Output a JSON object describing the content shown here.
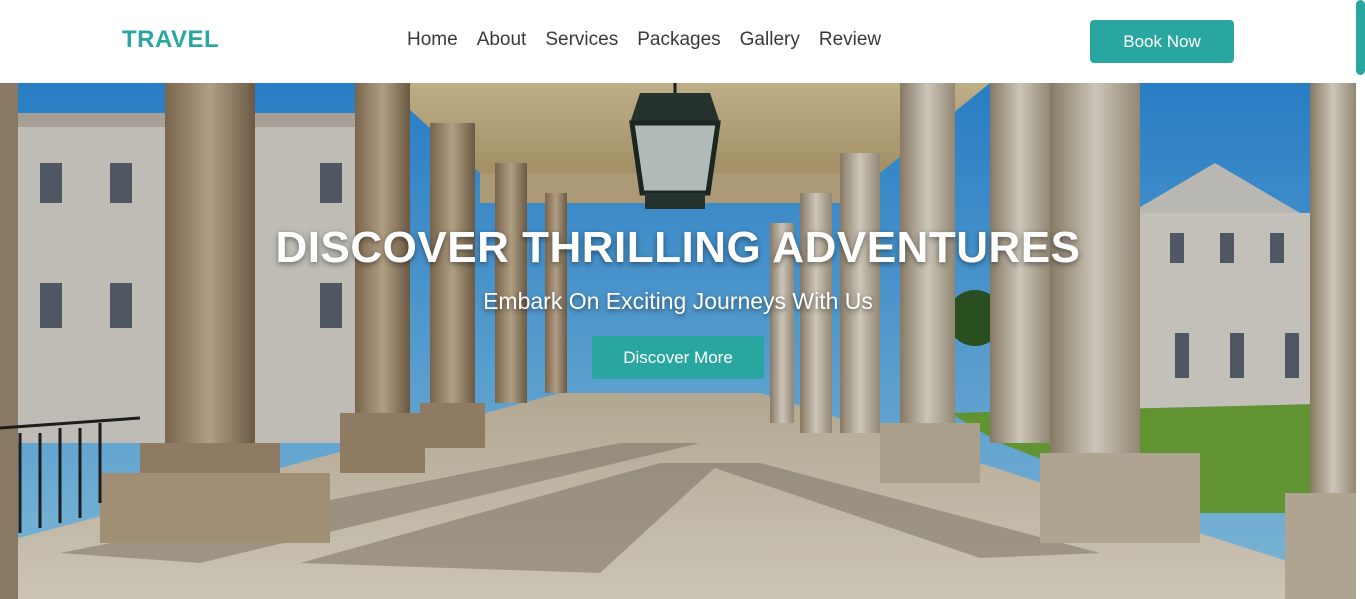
{
  "brand": {
    "logo_text": "TRAVEL"
  },
  "nav": {
    "items": [
      {
        "label": "Home"
      },
      {
        "label": "About"
      },
      {
        "label": "Services"
      },
      {
        "label": "Packages"
      },
      {
        "label": "Gallery"
      },
      {
        "label": "Review"
      }
    ],
    "cta_label": "Book Now"
  },
  "hero": {
    "title": "DISCOVER THRILLING ADVENTURES",
    "subtitle": "Embark On Exciting Journeys With Us",
    "button_label": "Discover More"
  },
  "colors": {
    "accent": "#2aa6a0",
    "nav_text": "#3a3a3a",
    "white": "#ffffff"
  }
}
